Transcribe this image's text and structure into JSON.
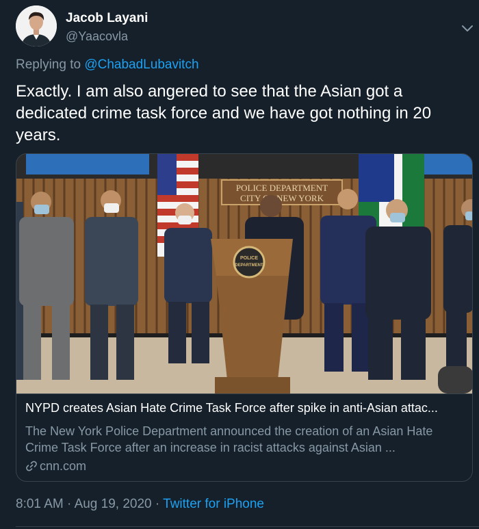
{
  "author": {
    "name": "Jacob Layani",
    "handle": "@Yaacovla"
  },
  "reply": {
    "prefix": "Replying to",
    "mention": "@ChabadLubavitch"
  },
  "tweet": {
    "text": "Exactly. I am also angered to see that the Asian got a dedicated crime task force and we have got nothing in 20 years."
  },
  "card": {
    "image_sign_line1": "POLICE DEPARTMENT",
    "image_sign_line2": "CITY OF NEW YORK",
    "podium_seal_line1": "POLICE",
    "podium_seal_line2": "DEPARTMENT",
    "title": "NYPD creates Asian Hate Crime Task Force after spike in anti-Asian attac...",
    "description": "The New York Police Department announced the creation of an Asian Hate Crime Task Force after an increase in racist attacks against Asian ...",
    "domain": "cnn.com"
  },
  "meta": {
    "time": "8:01 AM",
    "separator1": " · ",
    "date": "Aug 19, 2020",
    "separator2": " · ",
    "source": "Twitter for iPhone"
  },
  "icons": {
    "caret": "chevron-down-icon",
    "link": "link-icon"
  },
  "colors": {
    "background": "#15202b",
    "secondary_text": "#8899a6",
    "accent": "#1da1f2",
    "border": "#38444d"
  }
}
